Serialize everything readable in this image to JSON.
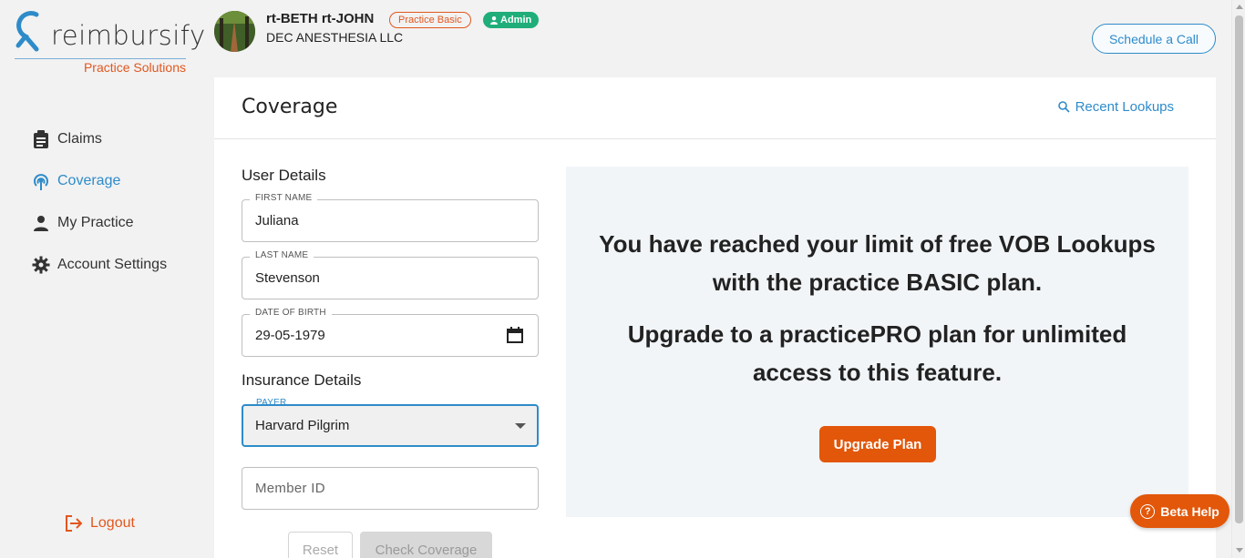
{
  "brand": {
    "name": "reimbursify",
    "tagline": "Practice Solutions",
    "accent": "#e2571e",
    "primary": "#2e8bc9"
  },
  "sidebar": {
    "items": [
      {
        "label": "Claims",
        "icon": "clipboard-icon",
        "active": false
      },
      {
        "label": "Coverage",
        "icon": "coverage-signal-icon",
        "active": true
      },
      {
        "label": "My Practice",
        "icon": "person-icon",
        "active": false
      },
      {
        "label": "Account Settings",
        "icon": "gear-icon",
        "active": false
      }
    ],
    "logout_label": "Logout"
  },
  "header": {
    "user_name": "rt-BETH rt-JOHN",
    "plan_badge": "Practice Basic",
    "role_badge": "Admin",
    "company": "DEC ANESTHESIA LLC",
    "schedule_label": "Schedule a Call"
  },
  "page": {
    "title": "Coverage",
    "recent_lookups_label": "Recent Lookups"
  },
  "form": {
    "user_details_heading": "User Details",
    "first_name": {
      "label": "FIRST NAME",
      "value": "Juliana"
    },
    "last_name": {
      "label": "LAST NAME",
      "value": "Stevenson"
    },
    "dob": {
      "label": "DATE OF BIRTH",
      "value": "29-05-1979"
    },
    "insurance_heading": "Insurance Details",
    "payer": {
      "label": "PAYER",
      "value": "Harvard Pilgrim"
    },
    "member_id": {
      "placeholder": "Member ID"
    },
    "reset_label": "Reset",
    "check_label": "Check Coverage"
  },
  "promo": {
    "line1a": "You have reached your limit of free VOB Lookups",
    "line1b": "with the practice BASIC plan.",
    "line2a": "Upgrade to a practicePRO plan for unlimited",
    "line2b": "access to this feature.",
    "upgrade_label": "Upgrade Plan"
  },
  "help": {
    "beta_label": "Beta Help"
  }
}
